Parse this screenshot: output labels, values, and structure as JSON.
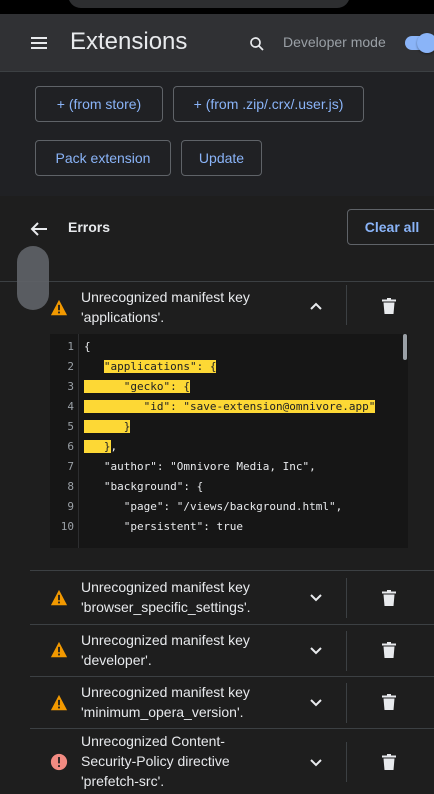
{
  "header": {
    "title": "Extensions",
    "developer_mode_label": "Developer mode",
    "developer_mode_on": true
  },
  "toolbar": {
    "from_store": "+ (from store)",
    "from_file": "+ (from .zip/.crx/.user.js)",
    "pack_extension": "Pack extension",
    "update": "Update"
  },
  "errors": {
    "title": "Errors",
    "clear_all": "Clear all",
    "items": [
      {
        "severity": "warning",
        "line1": "Unrecognized manifest key",
        "line2": "'applications'.",
        "line3": "",
        "expanded": true
      },
      {
        "severity": "warning",
        "line1": "Unrecognized manifest key",
        "line2": "'browser_specific_settings'.",
        "line3": "",
        "expanded": false
      },
      {
        "severity": "warning",
        "line1": "Unrecognized manifest key",
        "line2": "'developer'.",
        "line3": "",
        "expanded": false
      },
      {
        "severity": "warning",
        "line1": "Unrecognized manifest key",
        "line2": "'minimum_opera_version'.",
        "line3": "",
        "expanded": false
      },
      {
        "severity": "error",
        "line1": "Unrecognized Content-",
        "line2": "Security-Policy directive",
        "line3": "'prefetch-src'.",
        "expanded": false
      }
    ]
  },
  "code": {
    "lines": [
      {
        "n": "1",
        "pre": "{",
        "hl": "",
        "post": ""
      },
      {
        "n": "2",
        "pre": "   ",
        "hl": "\"applications\": {",
        "post": ""
      },
      {
        "n": "3",
        "pre": "",
        "hl": "      \"gecko\": {",
        "post": ""
      },
      {
        "n": "4",
        "pre": "",
        "hl": "         \"id\": \"save-extension@omnivore.app\"",
        "post": ""
      },
      {
        "n": "5",
        "pre": "",
        "hl": "      }",
        "post": ""
      },
      {
        "n": "6",
        "pre": "",
        "hl": "   }",
        "post": ","
      },
      {
        "n": "7",
        "pre": "   \"author\": \"Omnivore Media, Inc\",",
        "hl": "",
        "post": ""
      },
      {
        "n": "8",
        "pre": "   \"background\": {",
        "hl": "",
        "post": ""
      },
      {
        "n": "9",
        "pre": "      \"page\": \"/views/background.html\",",
        "hl": "",
        "post": ""
      },
      {
        "n": "10",
        "pre": "      \"persistent\": true",
        "hl": "",
        "post": ""
      }
    ]
  },
  "colors": {
    "accent": "#8ab4f8",
    "warning": "#f29900",
    "error": "#f28b82",
    "highlight": "#fdd835"
  }
}
